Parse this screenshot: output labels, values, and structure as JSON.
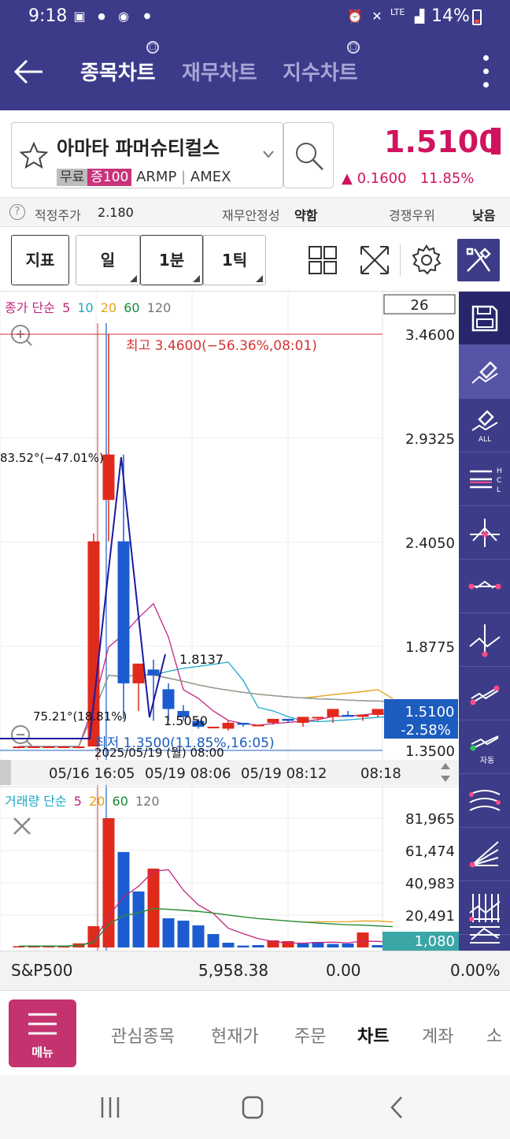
{
  "status": {
    "time": "9:18",
    "battery": "14%",
    "network": "LTE"
  },
  "appbar": {
    "tabs": [
      "종목차트",
      "재무차트",
      "지수차트"
    ]
  },
  "stock": {
    "name": "아마타 파머슈티컬스",
    "badge1": "무료",
    "badge2": "증100",
    "ticker": "ARMP",
    "exchange": "AMEX",
    "price": "1.5100",
    "change": "0.1600",
    "change_pct": "11.85%",
    "up_color": "#d0135f"
  },
  "info": {
    "fair_label": "적정주가",
    "fair_value": "2.180",
    "fin_label": "재무안정성",
    "fin_value": "약함",
    "comp_label": "경쟁우위",
    "comp_value": "낮음"
  },
  "toolbar": {
    "indicator": "지표",
    "day": "일",
    "minute": "1분",
    "tick": "1틱"
  },
  "chart_data": {
    "type": "candlestick",
    "price_legend_prefix": "종가 단순",
    "price_ma": [
      "5",
      "10",
      "20",
      "60",
      "120"
    ],
    "volume_legend_prefix": "거래량 단순",
    "volume_ma": [
      "5",
      "20",
      "60",
      "120"
    ],
    "zoom_level": "26",
    "y_ticks": [
      "3.4600",
      "2.9325",
      "2.4050",
      "1.8775",
      "1.3500"
    ],
    "y_range": [
      1.35,
      3.46
    ],
    "x_ticks": [
      "05/16 16:05",
      "05/19 08:06",
      "05/19 08:12",
      "08:18"
    ],
    "current_price": "1.5100",
    "current_pct": "-2.58%",
    "annot_high": "최고 3.4600(−56.36%,08:01)",
    "annot_low": "최저 1.3500(11.85%,16:05)",
    "annot_trend1": "83.52°(−47.01%)",
    "annot_trend2": "75.21°(18.81%)",
    "annot_1813": "1.8137",
    "annot_1505": "1.5050",
    "annot_date": "2025/05/19 (월) 08:00",
    "candles": [
      {
        "o": 1.37,
        "h": 1.37,
        "l": 1.36,
        "c": 1.37
      },
      {
        "o": 1.37,
        "h": 1.37,
        "l": 1.37,
        "c": 1.37
      },
      {
        "o": 1.37,
        "h": 1.37,
        "l": 1.37,
        "c": 1.37
      },
      {
        "o": 1.37,
        "h": 1.37,
        "l": 1.37,
        "c": 1.37
      },
      {
        "o": 1.37,
        "h": 1.37,
        "l": 1.36,
        "c": 1.37
      },
      {
        "o": 1.37,
        "h": 2.45,
        "l": 1.37,
        "c": 2.41
      },
      {
        "o": 2.62,
        "h": 3.46,
        "l": 2.41,
        "c": 2.85
      },
      {
        "o": 2.41,
        "h": 2.85,
        "l": 1.51,
        "c": 1.69
      },
      {
        "o": 1.69,
        "h": 1.74,
        "l": 1.55,
        "c": 1.79
      },
      {
        "o": 1.76,
        "h": 1.81,
        "l": 1.5,
        "c": 1.73
      },
      {
        "o": 1.66,
        "h": 1.69,
        "l": 1.5,
        "c": 1.56
      },
      {
        "o": 1.55,
        "h": 1.58,
        "l": 1.5,
        "c": 1.52
      },
      {
        "o": 1.5,
        "h": 1.51,
        "l": 1.46,
        "c": 1.47
      },
      {
        "o": 1.47,
        "h": 1.47,
        "l": 1.47,
        "c": 1.47
      },
      {
        "o": 1.46,
        "h": 1.5,
        "l": 1.45,
        "c": 1.49
      },
      {
        "o": 1.49,
        "h": 1.49,
        "l": 1.47,
        "c": 1.48
      },
      {
        "o": 1.48,
        "h": 1.48,
        "l": 1.48,
        "c": 1.48
      },
      {
        "o": 1.49,
        "h": 1.51,
        "l": 1.48,
        "c": 1.51
      },
      {
        "o": 1.51,
        "h": 1.51,
        "l": 1.49,
        "c": 1.5
      },
      {
        "o": 1.49,
        "h": 1.52,
        "l": 1.47,
        "c": 1.52
      },
      {
        "o": 1.52,
        "h": 1.52,
        "l": 1.5,
        "c": 1.52
      },
      {
        "o": 1.52,
        "h": 1.56,
        "l": 1.49,
        "c": 1.56
      },
      {
        "o": 1.53,
        "h": 1.55,
        "l": 1.52,
        "c": 1.52
      },
      {
        "o": 1.52,
        "h": 1.53,
        "l": 1.5,
        "c": 1.53
      },
      {
        "o": 1.53,
        "h": 1.56,
        "l": 1.52,
        "c": 1.56
      },
      {
        "o": 1.56,
        "h": 1.56,
        "l": 1.51,
        "c": 1.51
      }
    ],
    "volume_ticks": [
      "81,965",
      "61,474",
      "40,983",
      "20,491"
    ],
    "volume_range": [
      0,
      81965
    ],
    "current_volume": "1,080",
    "volumes": [
      800,
      1000,
      900,
      700,
      2600,
      13500,
      81965,
      60500,
      35500,
      50000,
      18500,
      17000,
      14000,
      8500,
      3000,
      1200,
      1500,
      4500,
      4000,
      2500,
      3500,
      2200,
      2500,
      9500,
      1500,
      1080
    ],
    "volume_colors": [
      "r",
      "r",
      "r",
      "r",
      "r",
      "r",
      "r",
      "b",
      "b",
      "r",
      "b",
      "b",
      "b",
      "b",
      "b",
      "b",
      "b",
      "r",
      "r",
      "b",
      "b",
      "b",
      "b",
      "r",
      "b",
      "b"
    ]
  },
  "sp500": {
    "label": "S&P500",
    "value": "5,958.38",
    "change": "0.00",
    "pct": "0.00%"
  },
  "bottomnav": {
    "menu": "메뉴",
    "items": [
      "관심종목",
      "현재가",
      "주문",
      "차트",
      "계좌",
      "소"
    ]
  }
}
